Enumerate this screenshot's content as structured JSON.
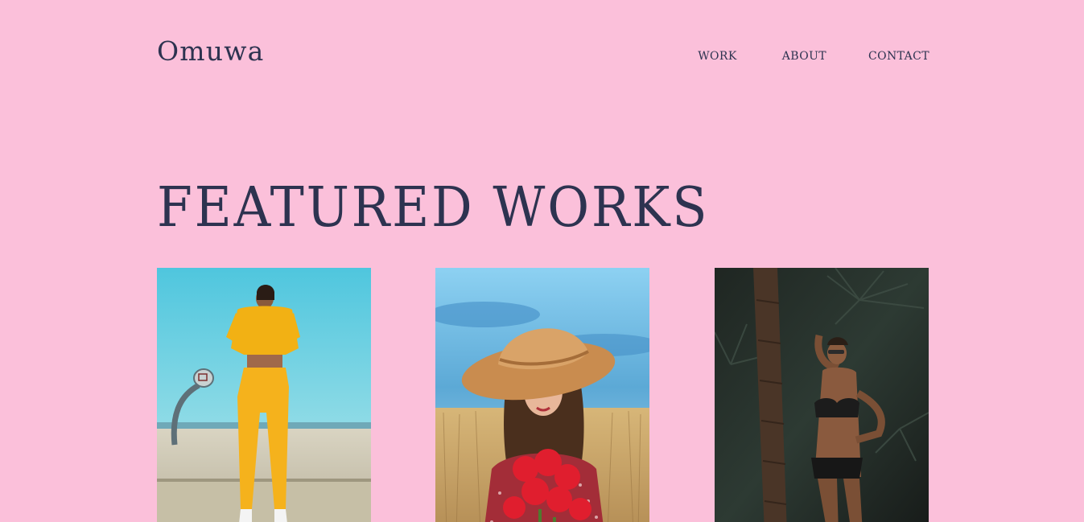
{
  "brand": {
    "name": "Omuwa"
  },
  "nav": {
    "items": [
      {
        "label": "WORK"
      },
      {
        "label": "ABOUT"
      },
      {
        "label": "CONTACT"
      }
    ]
  },
  "featured": {
    "title": "FEATURED WORKS",
    "works": [
      {
        "subject": "woman in yellow tracksuit by basketball hoop"
      },
      {
        "subject": "woman in straw hat holding red flowers in wheat field"
      },
      {
        "subject": "woman in black bikini by palm trees"
      }
    ]
  },
  "colors": {
    "background": "#FBC0DA",
    "text": "#2D3350"
  }
}
